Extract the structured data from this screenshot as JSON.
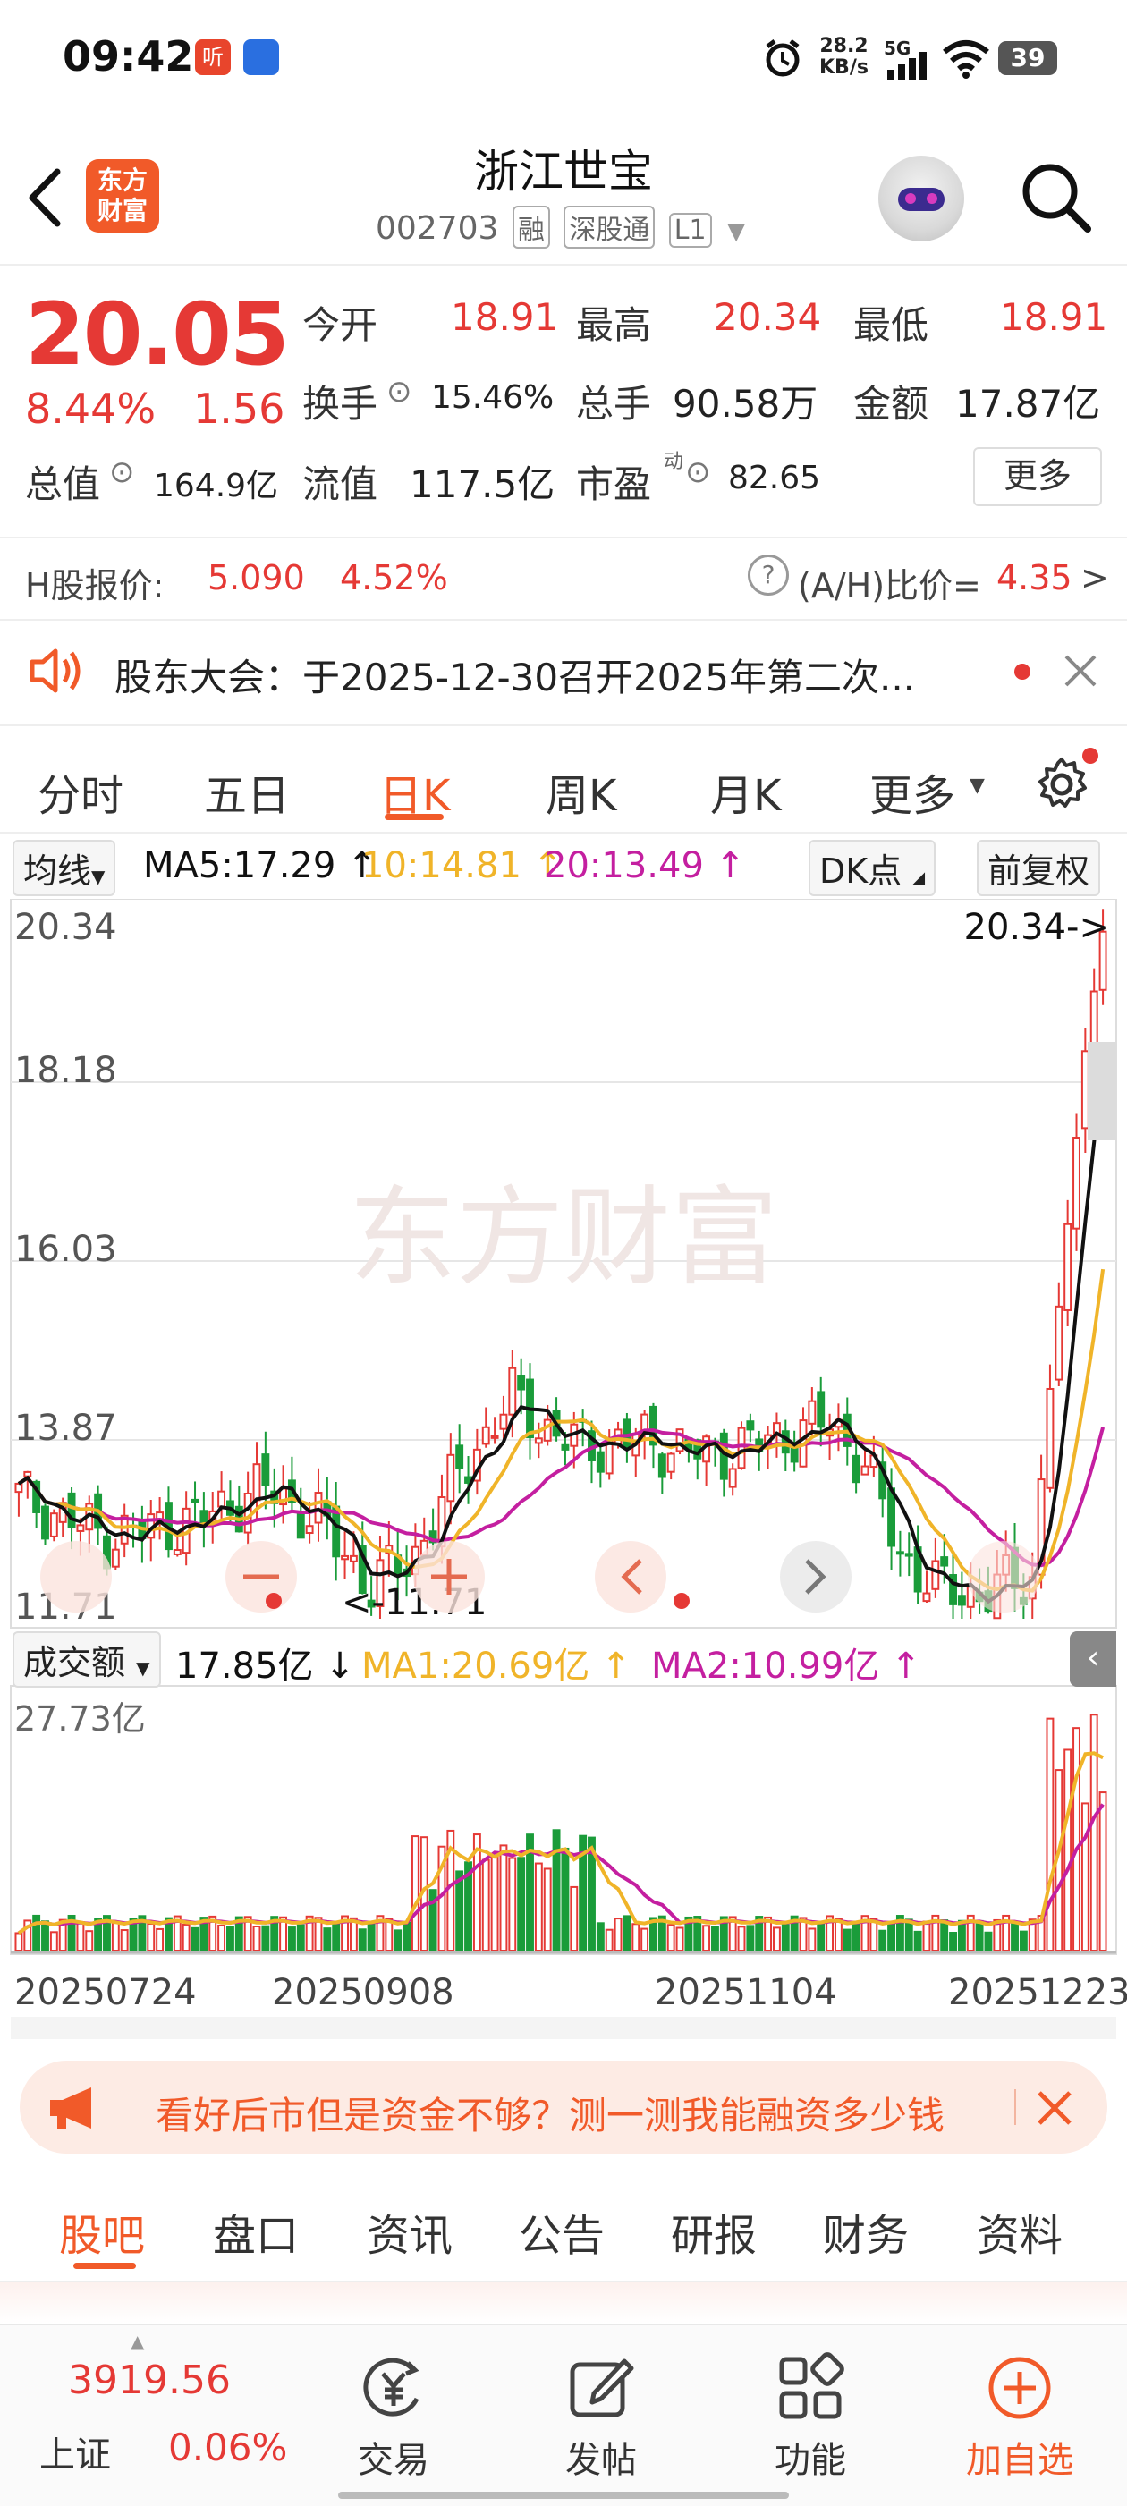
{
  "status_bar": {
    "time": "09:42",
    "app_icon_1": "听",
    "net_speed_value": "28.2",
    "net_speed_unit": "KB/s",
    "network": "5G",
    "battery": "39"
  },
  "header": {
    "logo_line1": "东方",
    "logo_line2": "财富",
    "stock_name": "浙江世宝",
    "stock_code": "002703",
    "tags": [
      "融",
      "深股通",
      "L1"
    ]
  },
  "quote": {
    "price": "20.05",
    "change_pct": "8.44%",
    "change_amt": "1.56",
    "fields": [
      {
        "label": "今开",
        "value": "18.91"
      },
      {
        "label": "最高",
        "value": "20.34"
      },
      {
        "label": "最低",
        "value": "18.91"
      },
      {
        "label": "换手",
        "value": "15.46%"
      },
      {
        "label": "总手",
        "value": "90.58万"
      },
      {
        "label": "金额",
        "value": "17.87亿"
      },
      {
        "label": "总值",
        "value": "164.9亿"
      },
      {
        "label": "流值",
        "value": "117.5亿"
      },
      {
        "label": "市盈",
        "value": "82.65"
      }
    ],
    "pe_superscript": "动",
    "more_label": "更多"
  },
  "hshare": {
    "label": "H股报价:",
    "price": "5.090",
    "pct": "4.52%",
    "ratio_label": "(A/H)比价=",
    "ratio_value": "4.35",
    "arrow": ">"
  },
  "notice": {
    "text": "股东大会：于2025-12-30召开2025年第二次..."
  },
  "period_tabs": [
    "分时",
    "五日",
    "日K",
    "周K",
    "月K",
    "更多"
  ],
  "active_period_tab": "日K",
  "ma_bar": {
    "selector": "均线",
    "ma5": "MA5:17.29",
    "ma10": "10:14.81",
    "ma20": "20:13.49",
    "dk_label": "DK点",
    "adjust_label": "前复权"
  },
  "chart_labels": {
    "y_ticks": [
      "20.34",
      "18.18",
      "16.03",
      "13.87",
      "11.71"
    ],
    "high_marker": "20.34->",
    "low_marker": "<-11.71",
    "watermark": "东方财富",
    "volume_selector": "成交额",
    "volume_value": "17.85亿",
    "volume_ma1": "MA1:20.69亿",
    "volume_ma2": "MA2:10.99亿",
    "volume_max": "27.73亿",
    "x_dates": [
      "20250724",
      "20250908",
      "20251104",
      "20251223"
    ]
  },
  "chart_data": {
    "type": "candlestick",
    "y_range": [
      11.71,
      20.34
    ],
    "ma_colors": {
      "ma5": "#111111",
      "ma10": "#f0b429",
      "ma20": "#c41fa0"
    },
    "up_color": "#e53935",
    "down_color": "#1a9c3a",
    "volume_max": 27.73
  },
  "promo": {
    "text": "看好后市但是资金不够？测一测我能融资多少钱"
  },
  "bottom_tabs": [
    "股吧",
    "盘口",
    "资讯",
    "公告",
    "研报",
    "财务",
    "资料"
  ],
  "active_bottom_tab": "股吧",
  "nav": {
    "index_value": "3919.56",
    "index_name": "上证",
    "index_pct": "0.06%",
    "items": [
      "交易",
      "发帖",
      "功能",
      "加自选"
    ]
  }
}
